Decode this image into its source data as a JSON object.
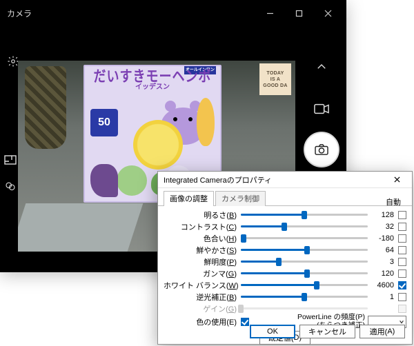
{
  "camera": {
    "title": "カメラ",
    "scene": {
      "sign_line1": "TODAY",
      "sign_line2": "IS A",
      "sign_line3": "GOOD DA",
      "box_headline": "だいすきモーヘンボ",
      "box_sub": "イッデスン",
      "box_strip": "オールインワン",
      "box_fifty": "50"
    }
  },
  "dialog": {
    "title": "Integrated Cameraのプロパティ",
    "tabs": {
      "img": "画像の調整",
      "ctrl": "カメラ制御"
    },
    "auto_header": "自動",
    "rows": [
      {
        "key": "brightness",
        "label": "明るさ",
        "mn": "B",
        "value": 128,
        "pct": 50,
        "auto": false,
        "enabled": true
      },
      {
        "key": "contrast",
        "label": "コントラスト",
        "mn": "C",
        "value": 32,
        "pct": 34,
        "auto": false,
        "enabled": true
      },
      {
        "key": "hue",
        "label": "色合い",
        "mn": "H",
        "value": -180,
        "pct": 2,
        "auto": false,
        "enabled": true
      },
      {
        "key": "saturation",
        "label": "鮮やかさ",
        "mn": "S",
        "value": 64,
        "pct": 52,
        "auto": false,
        "enabled": true
      },
      {
        "key": "sharpness",
        "label": "鮮明度",
        "mn": "P",
        "value": 3,
        "pct": 30,
        "auto": false,
        "enabled": true
      },
      {
        "key": "gamma",
        "label": "ガンマ",
        "mn": "G",
        "value": 120,
        "pct": 52,
        "auto": false,
        "enabled": true
      },
      {
        "key": "whitebalance",
        "label": "ホワイト バランス",
        "mn": "W",
        "value": 4600,
        "pct": 60,
        "auto": true,
        "enabled": true
      },
      {
        "key": "backlight",
        "label": "逆光補正",
        "mn": "B",
        "value": 1,
        "pct": 50,
        "auto": false,
        "enabled": true
      },
      {
        "key": "gain",
        "label": "ゲイン",
        "mn": "G",
        "value": "",
        "pct": 0,
        "auto": false,
        "enabled": false
      }
    ],
    "color_enable": {
      "label": "色の使用",
      "mn": "E",
      "checked": true
    },
    "powerline": {
      "label_l1": "PowerLine の頻度",
      "mn": "P",
      "label_l2": "(ちらつき補正)",
      "value": ""
    },
    "defaults_btn": "既定値",
    "defaults_mn": "D",
    "buttons": {
      "ok": "OK",
      "cancel": "キャンセル",
      "apply": "適用",
      "apply_mn": "A"
    }
  }
}
